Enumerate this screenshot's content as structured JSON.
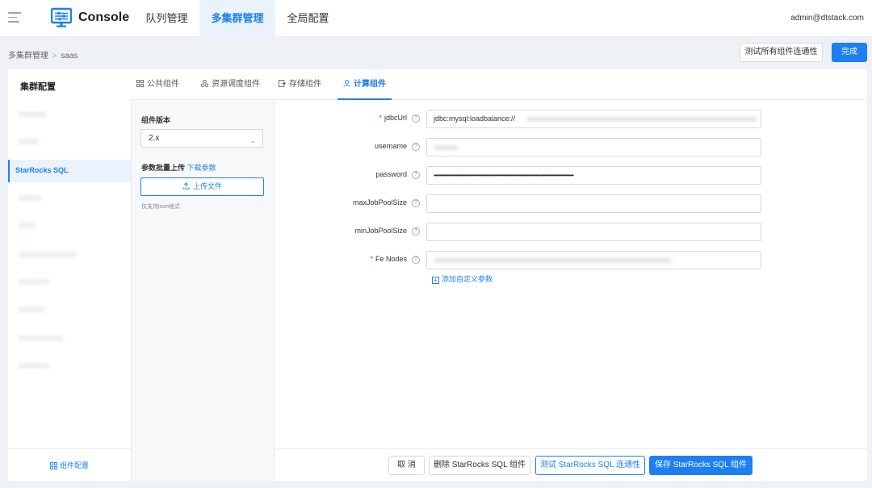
{
  "header": {
    "brand": "Console",
    "tabs": [
      {
        "label": "队列管理"
      },
      {
        "label": "多集群管理"
      },
      {
        "label": "全局配置"
      }
    ],
    "user_email": "admin@dtstack.com"
  },
  "breadcrumb": {
    "items": [
      "多集群管理",
      "saas"
    ]
  },
  "actions": {
    "test_all": "测试所有组件连通性",
    "done": "完成"
  },
  "panel": {
    "title": "集群配置",
    "tabs": [
      {
        "label": "公共组件",
        "icon": "grid-icon"
      },
      {
        "label": "资源调度组件",
        "icon": "cluster-icon"
      },
      {
        "label": "存储组件",
        "icon": "storage-icon"
      },
      {
        "label": "计算组件",
        "icon": "user-icon"
      }
    ],
    "cluster_items": [
      "StarRocks SQL"
    ],
    "component_config": "组件配置"
  },
  "version": {
    "label": "组件版本",
    "value": "2.x"
  },
  "upload": {
    "label": "参数批量上传",
    "download_link": "下载参数",
    "button": "上传文件",
    "hint": "仅支持json格式"
  },
  "form": {
    "fields": [
      {
        "label": "jdbcUrl",
        "required": true,
        "value": "jdbc:mysql:loadbalance://"
      },
      {
        "label": "username",
        "required": false,
        "value": ""
      },
      {
        "label": "password",
        "required": false,
        "value": "••••••••••••••••••••••••••••••••••••••••••••••••••••••••••••••••••••••••••••••••••••••••••••••••"
      },
      {
        "label": "maxJobPoolSize",
        "required": false,
        "value": ""
      },
      {
        "label": "minJobPoolSize",
        "required": false,
        "value": ""
      },
      {
        "label": "Fe Nodes",
        "required": true,
        "value": ""
      }
    ],
    "add_param": "添加自定义参数"
  },
  "footer": {
    "cancel": "取 消",
    "delete": "删除 StarRocks SQL 组件",
    "test": "测试 StarRocks SQL 连通性",
    "save": "保存 StarRocks SQL 组件"
  }
}
